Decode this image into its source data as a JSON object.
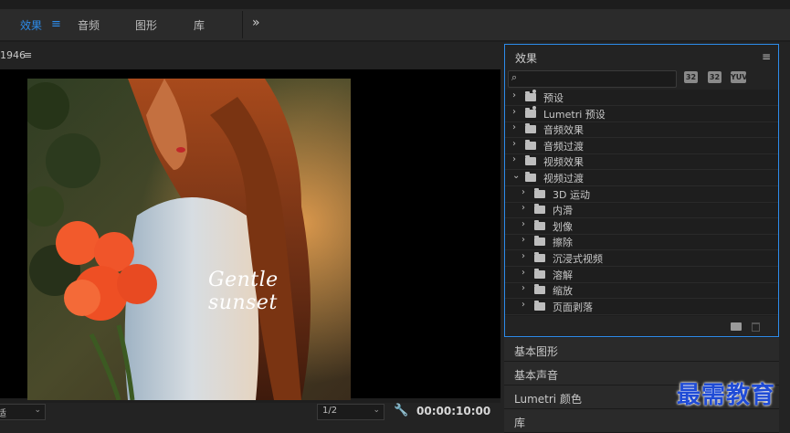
{
  "workspaces": {
    "tabs": [
      {
        "label": "效果",
        "active": true
      },
      {
        "label": "音频",
        "active": false
      },
      {
        "label": "图形",
        "active": false
      },
      {
        "label": "库",
        "active": false
      }
    ],
    "menu_icon": "hamburger-icon",
    "more_icon": "double-chevron-right-icon"
  },
  "monitor": {
    "frame_label": "1946",
    "overlay_text": "Gentle sunset",
    "zoom_value": "适",
    "resolution_value": "1/2",
    "timecode": "00:00:10:00"
  },
  "effects_panel": {
    "title": "效果",
    "search_placeholder": "",
    "buttons": [
      "32",
      "32",
      "YUV"
    ],
    "items": [
      {
        "label": "预设",
        "level": 0,
        "expanded": false,
        "icon": "preset-folder-icon"
      },
      {
        "label": "Lumetri 预设",
        "level": 0,
        "expanded": false,
        "icon": "preset-folder-icon"
      },
      {
        "label": "音频效果",
        "level": 0,
        "expanded": false,
        "icon": "folder-icon"
      },
      {
        "label": "音频过渡",
        "level": 0,
        "expanded": false,
        "icon": "folder-icon"
      },
      {
        "label": "视频效果",
        "level": 0,
        "expanded": false,
        "icon": "folder-icon"
      },
      {
        "label": "视频过渡",
        "level": 0,
        "expanded": true,
        "icon": "folder-icon"
      },
      {
        "label": "3D 运动",
        "level": 1,
        "expanded": false,
        "icon": "folder-icon"
      },
      {
        "label": "内滑",
        "level": 1,
        "expanded": false,
        "icon": "folder-icon"
      },
      {
        "label": "划像",
        "level": 1,
        "expanded": false,
        "icon": "folder-icon"
      },
      {
        "label": "擦除",
        "level": 1,
        "expanded": false,
        "icon": "folder-icon"
      },
      {
        "label": "沉浸式视频",
        "level": 1,
        "expanded": false,
        "icon": "folder-icon"
      },
      {
        "label": "溶解",
        "level": 1,
        "expanded": false,
        "icon": "folder-icon"
      },
      {
        "label": "缩放",
        "level": 1,
        "expanded": false,
        "icon": "folder-icon"
      },
      {
        "label": "页面剥落",
        "level": 1,
        "expanded": false,
        "icon": "folder-icon"
      }
    ]
  },
  "collapsed_panels": [
    "基本图形",
    "基本声音",
    "Lumetri 颜色",
    "库"
  ],
  "watermark": "最需教育",
  "colors": {
    "accent": "#2d8ceb",
    "panel": "#232323",
    "watermark": "#1f4bd6"
  }
}
